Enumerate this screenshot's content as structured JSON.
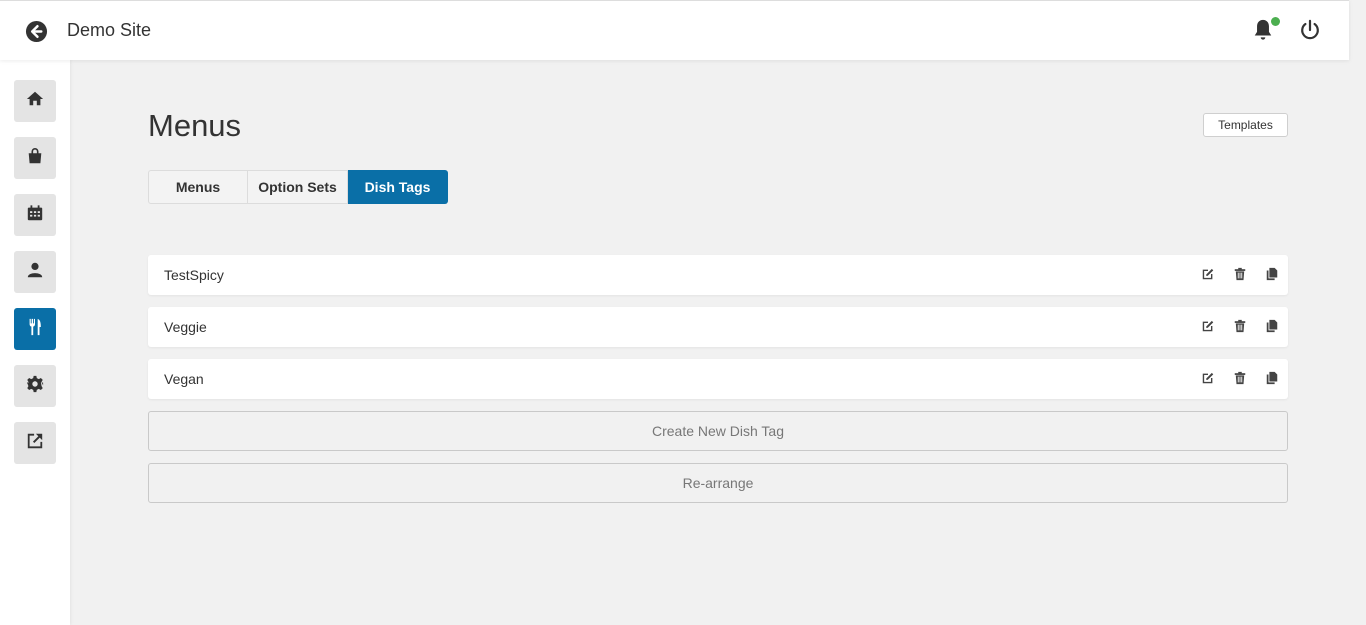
{
  "header": {
    "title": "Demo Site",
    "back_icon": "back-arrow-circle-icon",
    "bell_icon": "bell-icon",
    "power_icon": "power-icon",
    "notification_dot_color": "#4caf50"
  },
  "sidebar": {
    "items": [
      {
        "name": "home",
        "icon": "home-icon"
      },
      {
        "name": "orders",
        "icon": "shopping-bag-icon"
      },
      {
        "name": "bookings",
        "icon": "calendar-icon"
      },
      {
        "name": "customers",
        "icon": "user-icon"
      },
      {
        "name": "menus",
        "icon": "fork-knife-icon",
        "active": true
      },
      {
        "name": "settings",
        "icon": "gear-icon"
      },
      {
        "name": "external",
        "icon": "external-link-icon"
      }
    ],
    "active_color": "#0a6fa7"
  },
  "main": {
    "title": "Menus",
    "templates_label": "Templates",
    "tabs": [
      {
        "label": "Menus",
        "active": false
      },
      {
        "label": "Option Sets",
        "active": false
      },
      {
        "label": "Dish Tags",
        "active": true
      }
    ],
    "dish_tags": [
      {
        "name": "TestSpicy"
      },
      {
        "name": "Veggie"
      },
      {
        "name": "Vegan"
      }
    ],
    "row_actions": [
      "edit-icon",
      "trash-icon",
      "copy-icon"
    ],
    "create_label": "Create New Dish Tag",
    "rearrange_label": "Re-arrange"
  }
}
